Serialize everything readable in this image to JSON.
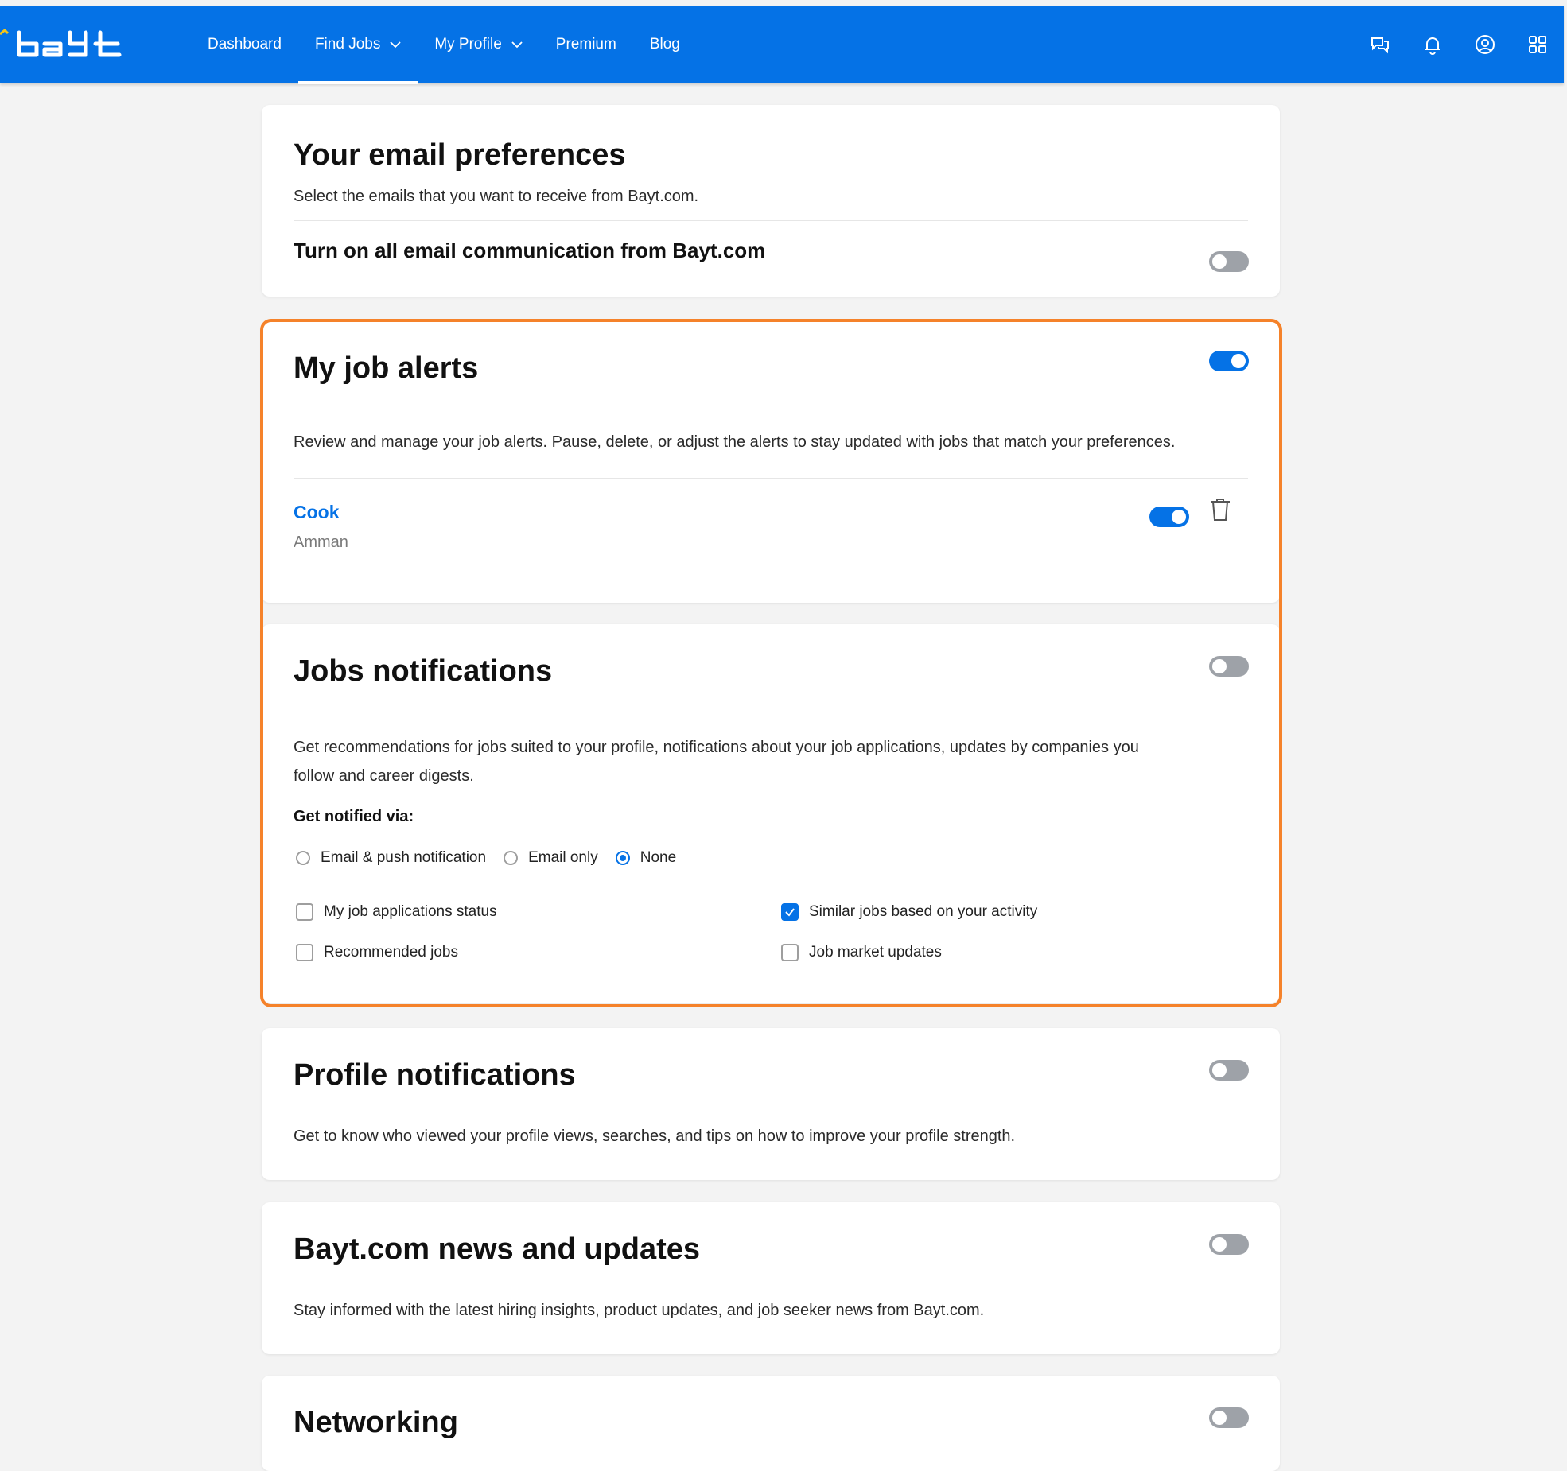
{
  "header": {
    "logo_text": "bayt",
    "nav": [
      {
        "label": "Dashboard"
      },
      {
        "label": "Find Jobs"
      },
      {
        "label": "My Profile"
      },
      {
        "label": "Premium"
      },
      {
        "label": "Blog"
      }
    ],
    "active_nav": "Find Jobs",
    "icons": [
      "chat-icon",
      "bell-icon",
      "user-circle-icon",
      "apps-grid-icon"
    ]
  },
  "email_prefs": {
    "title": "Your email preferences",
    "description": "Select the emails that you want to receive from Bayt.com.",
    "all_label": "Turn on all email communication from Bayt.com",
    "all_on": false
  },
  "job_alerts": {
    "title": "My job alerts",
    "enabled": true,
    "description": "Review and manage your job alerts. Pause, delete, or adjust the alerts to stay updated with jobs that match your preferences.",
    "alerts": [
      {
        "name": "Cook",
        "location": "Amman",
        "enabled": true
      }
    ]
  },
  "jobs_notifications": {
    "title": "Jobs notifications",
    "enabled": false,
    "description_line1": "Get recommendations for jobs suited to your profile, notifications about your job applications, updates by companies you",
    "description_line2": "follow and career digests.",
    "notify_label": "Get notified via:",
    "channels": [
      {
        "label": "Email & push notification",
        "selected": false
      },
      {
        "label": "Email only",
        "selected": false
      },
      {
        "label": "None",
        "selected": true
      }
    ],
    "options": [
      {
        "label": "My job applications status",
        "checked": false
      },
      {
        "label": "Similar jobs based on your activity",
        "checked": true
      },
      {
        "label": "Recommended jobs",
        "checked": false
      },
      {
        "label": "Job market updates",
        "checked": false
      }
    ]
  },
  "profile_notifications": {
    "title": "Profile notifications",
    "enabled": false,
    "description": "Get to know who viewed your profile views, searches, and tips on how to improve your profile strength."
  },
  "news": {
    "title": "Bayt.com news and updates",
    "enabled": false,
    "description": "Stay informed with the latest hiring insights, product updates, and job seeker news from Bayt.com."
  },
  "networking": {
    "title": "Networking",
    "enabled": false
  },
  "colors": {
    "brand_blue": "#0572e6",
    "highlight_orange": "#f5822a",
    "toggle_off": "#9ea2a8"
  }
}
